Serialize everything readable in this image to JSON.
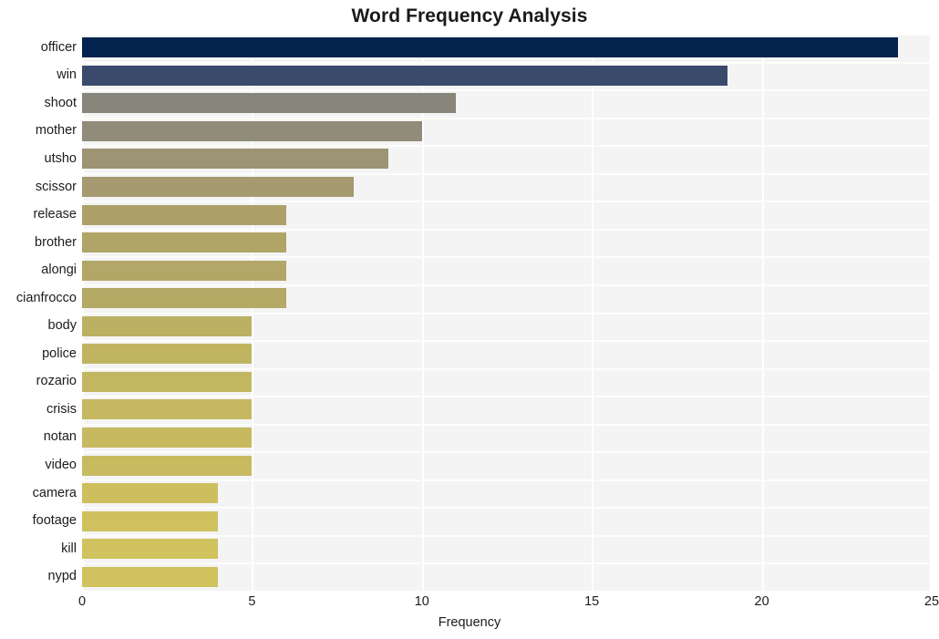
{
  "chart_data": {
    "type": "bar",
    "orientation": "horizontal",
    "title": "Word Frequency Analysis",
    "xlabel": "Frequency",
    "ylabel": "",
    "xlim": [
      0,
      25
    ],
    "xticks": [
      0,
      5,
      10,
      15,
      20,
      25
    ],
    "xtick_labels": [
      "0",
      "5",
      "10",
      "15",
      "20",
      "25"
    ],
    "grid": true,
    "legend": null,
    "categories": [
      "officer",
      "win",
      "shoot",
      "mother",
      "utsho",
      "scissor",
      "release",
      "brother",
      "alongi",
      "cianfrocco",
      "body",
      "police",
      "rozario",
      "crisis",
      "notan",
      "video",
      "camera",
      "footage",
      "kill",
      "nypd"
    ],
    "values": [
      24,
      19,
      11,
      10,
      9,
      8,
      6,
      6,
      6,
      6,
      5,
      5,
      5,
      5,
      5,
      5,
      4,
      4,
      4,
      4
    ],
    "bar_colors": [
      "#04244f",
      "#3a4a6d",
      "#88857a",
      "#918c79",
      "#9c9473",
      "#a59a70",
      "#ada169",
      "#b0a567",
      "#b2a766",
      "#b4a965",
      "#bcb063",
      "#c0b461",
      "#c3b660",
      "#c5b860",
      "#c6b95f",
      "#c7ba5f",
      "#cdbf5e",
      "#cfc15e",
      "#d0c25d",
      "#d0c25d"
    ],
    "plot_background": "#f4f4f5",
    "gridline_color": "#ffffff",
    "figure_background": "#ffffff"
  }
}
